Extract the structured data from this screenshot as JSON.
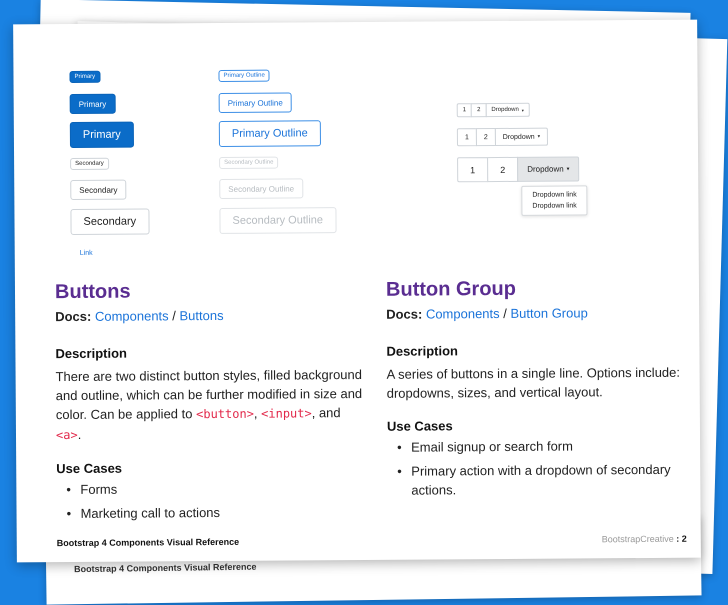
{
  "background_color": "#1a82e2",
  "back_sheet": {
    "footer": "Bootstrap 4 Components Visual Reference"
  },
  "buttons_demo": {
    "primary": [
      "Primary",
      "Primary",
      "Primary"
    ],
    "secondary": [
      "Secondary",
      "Secondary",
      "Secondary"
    ],
    "link": "Link",
    "primary_outline": [
      "Primary Outline",
      "Primary Outline",
      "Primary Outline"
    ],
    "secondary_outline": [
      "Secondary Outline",
      "Secondary Outline",
      "Secondary Outline"
    ]
  },
  "group_demo": {
    "one": "1",
    "two": "2",
    "dropdown": "Dropdown",
    "menu_items": [
      "Dropdown link",
      "Dropdown link"
    ]
  },
  "left": {
    "title": "Buttons",
    "docs_label": "Docs:",
    "docs_link1": "Components",
    "docs_sep": " / ",
    "docs_link2": "Buttons",
    "description_heading": "Description",
    "description_text": "There are two distinct button styles, filled background and outline, which can be further modified in size and color. Can be applied to",
    "code_button": "<button>",
    "code_input": "<input>",
    "code_a": "<a>",
    "sep_comma": ", ",
    "sep_and": ", and ",
    "period": ".",
    "use_cases_heading": "Use Cases",
    "use_cases": [
      "Forms",
      "Marketing call to actions"
    ]
  },
  "right": {
    "title": "Button Group",
    "docs_label": "Docs:",
    "docs_link1": "Components",
    "docs_sep": " / ",
    "docs_link2": "Button Group",
    "description_heading": "Description",
    "description_text": "A series of buttons in a single line. Options include: dropdowns, sizes, and vertical layout.",
    "use_cases_heading": "Use Cases",
    "use_cases": [
      "Email signup or search form",
      "Primary action with a dropdown of secondary actions."
    ]
  },
  "footer": {
    "left": "Bootstrap 4 Components Visual Reference",
    "brand": "BootstrapCreative",
    "page_sep": " : ",
    "page": "2"
  }
}
